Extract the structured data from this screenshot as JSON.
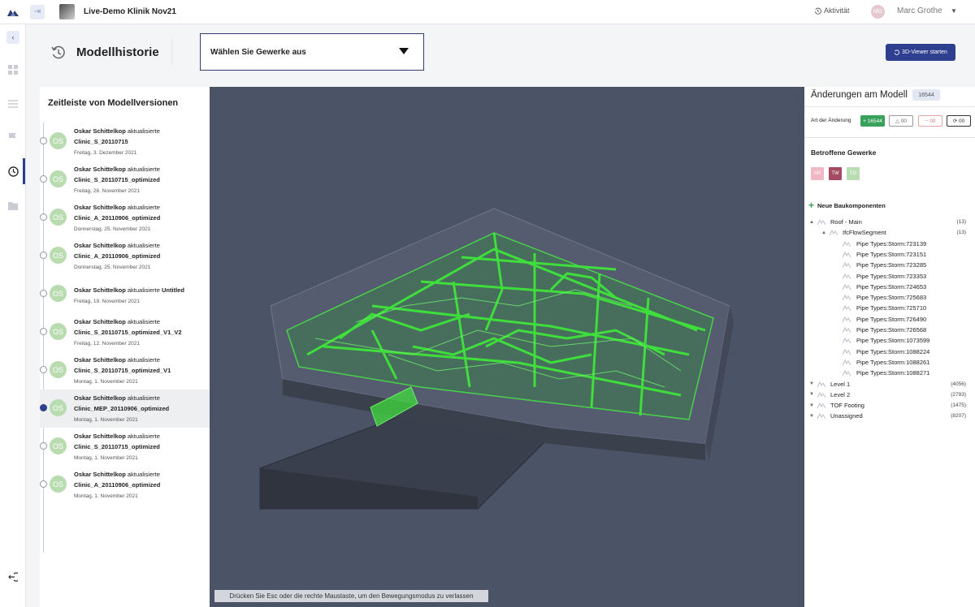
{
  "topbar": {
    "project_title": "Live-Demo Klinik Nov21",
    "activity_label": "Aktivität",
    "avatar_initials": "MG",
    "user_name": "Marc Grothe"
  },
  "header": {
    "title": "Modellhistorie",
    "gewerke_placeholder": "Wählen Sie Gewerke aus",
    "viewer_button": "3D-Viewer starten"
  },
  "timeline": {
    "title": "Zeitleiste von Modellversionen",
    "versions": [
      {
        "initials": "OS",
        "author": "Oskar Schittelkop",
        "action": "aktualisierte",
        "file": "Clinic_S_20110715",
        "date": "Freitag, 3. Dezember 2021"
      },
      {
        "initials": "OS",
        "author": "Oskar Schittelkop",
        "action": "aktualisierte",
        "file": "Clinic_S_20110715_optimized",
        "date": "Freitag, 26. November 2021"
      },
      {
        "initials": "OS",
        "author": "Oskar Schittelkop",
        "action": "aktualisierte",
        "file": "Clinic_A_20110906_optimized",
        "date": "Donnerstag, 25. November 2021"
      },
      {
        "initials": "OS",
        "author": "Oskar Schittelkop",
        "action": "aktualisierte",
        "file": "Clinic_A_20110906_optimized",
        "date": "Donnerstag, 25. November 2021"
      },
      {
        "initials": "OS",
        "author": "Oskar Schittelkop",
        "action": "aktualisierte",
        "file": "Untitled",
        "date": "Freitag, 19. November 2021"
      },
      {
        "initials": "OS",
        "author": "Oskar Schittelkop",
        "action": "aktualisierte",
        "file": "Clinic_S_20110715_optimized_V1_V2",
        "date": "Freitag, 12. November 2021"
      },
      {
        "initials": "OS",
        "author": "Oskar Schittelkop",
        "action": "aktualisierte",
        "file": "Clinic_S_20110715_optimized_V1",
        "date": "Montag, 1. November 2021"
      },
      {
        "initials": "OS",
        "author": "Oskar Schittelkop",
        "action": "aktualisierte",
        "file": "Clinic_MEP_20110906_optimized",
        "date": "Montag, 1. November 2021",
        "active": true
      },
      {
        "initials": "OS",
        "author": "Oskar Schittelkop",
        "action": "aktualisierte",
        "file": "Clinic_S_20110715_optimized",
        "date": "Montag, 1. November 2021"
      },
      {
        "initials": "OS",
        "author": "Oskar Schittelkop",
        "action": "aktualisierte",
        "file": "Clinic_A_20110906_optimized",
        "date": "Montag, 1. November 2021"
      }
    ]
  },
  "viewport": {
    "esc_hint": "Drücken Sie Esc oder die rechte Maustaste, um den Bewegungsmodus zu verlassen"
  },
  "changes": {
    "title": "Änderungen am Modell",
    "total": "16544",
    "art_label": "Art der Änderung",
    "added": "16544",
    "deleted": "00",
    "modified": "00",
    "moved": "00",
    "betroffene_title": "Betroffene Gewerke",
    "trades": [
      {
        "code": "AR",
        "color": "#efb8c4"
      },
      {
        "code": "TW",
        "color": "#a54a63"
      },
      {
        "code": "TG",
        "color": "#b9dcb5"
      }
    ],
    "neue_label": "Neue Baukomponenten",
    "tree": [
      {
        "label": "Roof - Main",
        "count": "(13)",
        "level": 0,
        "expanded": true
      },
      {
        "label": "IfcFlowSegment",
        "count": "(13)",
        "level": 1,
        "expanded": true
      },
      {
        "label": "Pipe Types:Storm:723139",
        "count": "",
        "level": 2
      },
      {
        "label": "Pipe Types:Storm:723151",
        "count": "",
        "level": 2
      },
      {
        "label": "Pipe Types:Storm:723285",
        "count": "",
        "level": 2
      },
      {
        "label": "Pipe Types:Storm:723353",
        "count": "",
        "level": 2
      },
      {
        "label": "Pipe Types:Storm:724653",
        "count": "",
        "level": 2
      },
      {
        "label": "Pipe Types:Storm:725683",
        "count": "",
        "level": 2
      },
      {
        "label": "Pipe Types:Storm:725710",
        "count": "",
        "level": 2
      },
      {
        "label": "Pipe Types:Storm:726490",
        "count": "",
        "level": 2
      },
      {
        "label": "Pipe Types:Storm:726568",
        "count": "",
        "level": 2
      },
      {
        "label": "Pipe Types:Storm:1073599",
        "count": "",
        "level": 2
      },
      {
        "label": "Pipe Types:Storm:1088224",
        "count": "",
        "level": 2
      },
      {
        "label": "Pipe Types:Storm:1088261",
        "count": "",
        "level": 2
      },
      {
        "label": "Pipe Types:Storm:1088271",
        "count": "",
        "level": 2
      },
      {
        "label": "Level 1",
        "count": "(4056)",
        "level": 0,
        "expanded": false
      },
      {
        "label": "Level 2",
        "count": "(2793)",
        "level": 0,
        "expanded": false
      },
      {
        "label": "TOF Footing",
        "count": "(1475)",
        "level": 0,
        "expanded": false
      },
      {
        "label": "Unassigned",
        "count": "(8207)",
        "level": 0,
        "expanded": false
      }
    ]
  },
  "colors": {
    "accent": "#2d3f8e",
    "added_green": "#3aa15a",
    "viewport_bg": "#4b5367",
    "model_green": "#3ee53a"
  }
}
